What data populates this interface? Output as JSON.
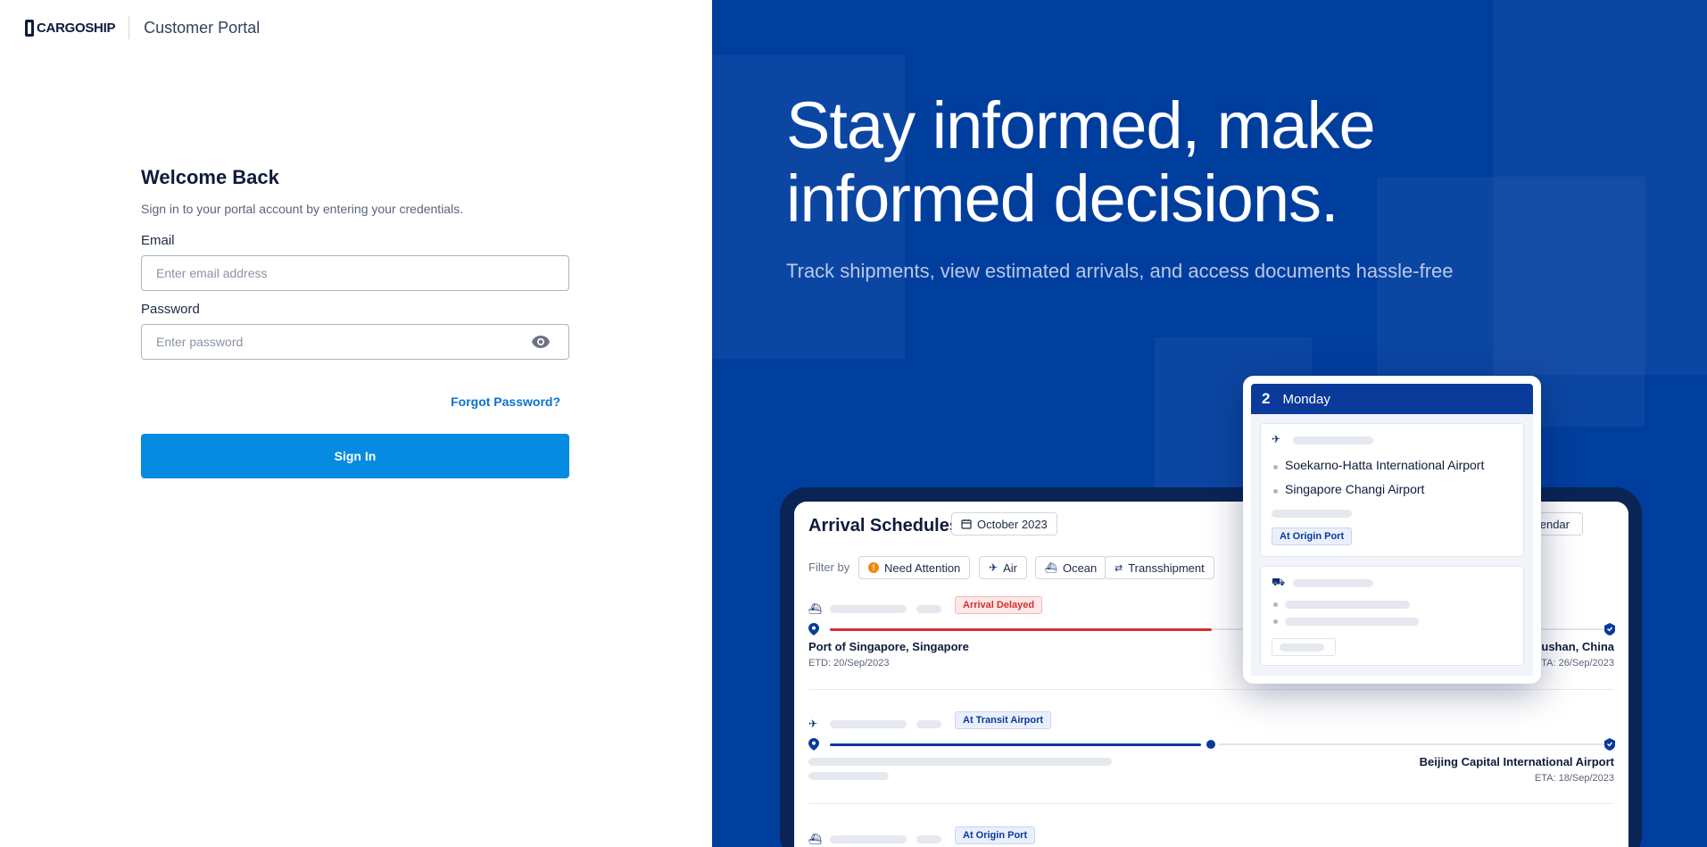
{
  "header": {
    "logo_text": "CARGOSHIP",
    "portal_name": "Customer Portal"
  },
  "login": {
    "title": "Welcome Back",
    "subtitle": "Sign in to your portal account by entering your credentials.",
    "email_label": "Email",
    "email_placeholder": "Enter email address",
    "email_value": "",
    "password_label": "Password",
    "password_placeholder": "Enter password",
    "password_value": "",
    "forgot_label": "Forgot Password?",
    "signin_label": "Sign In"
  },
  "hero": {
    "headline_line1": "Stay informed, make",
    "headline_line2": "informed decisions.",
    "tagline": "Track shipments, view estimated arrivals, and access documents hassle-free"
  },
  "schedules": {
    "title": "Arrival Schedules",
    "month": "October 2023",
    "view_toggle": "Calendar",
    "filter_label": "Filter by",
    "filters": [
      "Need Attention",
      "Air",
      "Ocean",
      "Transshipment"
    ],
    "shipments": [
      {
        "status": "Arrival Delayed",
        "origin": "Port of Singapore, Singapore",
        "etd": "ETD: 20/Sep/2023",
        "destination": "oushan, China",
        "eta": "ETA: 26/Sep/2023"
      },
      {
        "status": "At Transit Airport",
        "destination": "Beijing Capital International Airport",
        "eta": "ETA: 18/Sep/2023"
      },
      {
        "status": "At Origin Port"
      }
    ]
  },
  "calendar_card": {
    "day": "2",
    "weekday": "Monday",
    "airports": [
      "Soekarno-Hatta International Airport",
      "Singapore Changi Airport"
    ],
    "status": "At Origin Port"
  },
  "colors": {
    "brand_blue": "#003e9e",
    "button_blue": "#068be3",
    "delay_red": "#d3302f"
  }
}
